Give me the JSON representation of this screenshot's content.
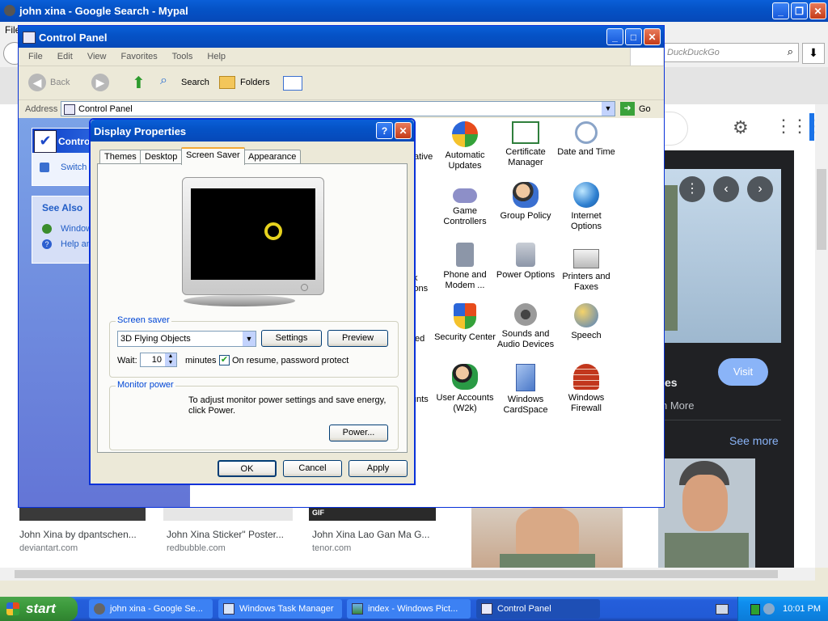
{
  "browser": {
    "title": "john xina - Google Search - Mypal",
    "menu_file": "File",
    "search_placeholder": "DuckDuckGo",
    "cards": [
      {
        "title": "John Xina by dpantschen...",
        "source": "deviantart.com"
      },
      {
        "title": "John Xina Sticker\" Poster...",
        "source": "redbubble.com"
      },
      {
        "title": "John Xina Lao Gan Ma G...",
        "source": "tenor.com"
      }
    ],
    "gif_badge": "GIF",
    "visit_label": "Visit",
    "partial_es": "es",
    "partial_more": "n More",
    "see_more": "See more"
  },
  "control_panel": {
    "title": "Control Panel",
    "menu": [
      "File",
      "Edit",
      "View",
      "Favorites",
      "Tools",
      "Help"
    ],
    "toolbar": {
      "back": "Back",
      "search": "Search",
      "folders": "Folders"
    },
    "address_label": "Address",
    "address_value": "Control Panel",
    "go_label": "Go",
    "sidebar": {
      "panel_title": "Contro",
      "switch_link": "Switch",
      "see_also": "See Also",
      "link1": "Window",
      "link2": "Help an"
    },
    "partial_labels": [
      "ative",
      "k",
      "ions",
      "ed",
      "unts"
    ],
    "icons": [
      {
        "label": "Automatic Updates",
        "icon": "automatic-updates-icon"
      },
      {
        "label": "Certificate Manager",
        "icon": "certificate-icon"
      },
      {
        "label": "Date and Time",
        "icon": "clock-icon"
      },
      {
        "label": "Game Controllers",
        "icon": "gamepad-icon"
      },
      {
        "label": "Group Policy",
        "icon": "group-policy-icon"
      },
      {
        "label": "Internet Options",
        "icon": "globe-icon"
      },
      {
        "label": "Phone and Modem ...",
        "icon": "phone-icon"
      },
      {
        "label": "Power Options",
        "icon": "power-icon"
      },
      {
        "label": "Printers and Faxes",
        "icon": "printer-icon"
      },
      {
        "label": "Security Center",
        "icon": "shield-icon"
      },
      {
        "label": "Sounds and Audio Devices",
        "icon": "speaker-icon"
      },
      {
        "label": "Speech",
        "icon": "speech-icon"
      },
      {
        "label": "User Accounts (W2k)",
        "icon": "users-icon"
      },
      {
        "label": "Windows CardSpace",
        "icon": "cardspace-icon"
      },
      {
        "label": "Windows Firewall",
        "icon": "firewall-icon"
      }
    ]
  },
  "dialog": {
    "title": "Display Properties",
    "help_glyph": "?",
    "tabs": [
      "Themes",
      "Desktop",
      "Screen Saver",
      "Appearance"
    ],
    "active_tab": "Screen Saver",
    "screensaver_group": "Screen saver",
    "screensaver_value": "3D Flying Objects",
    "settings_button": "Settings",
    "preview_button": "Preview",
    "wait_label": "Wait:",
    "wait_value": "10",
    "minutes_label": "minutes",
    "password_label": "On resume, password protect",
    "password_checked": true,
    "monitor_group": "Monitor power",
    "monitor_text": "To adjust monitor power settings and save energy, click Power.",
    "power_button": "Power...",
    "ok": "OK",
    "cancel": "Cancel",
    "apply": "Apply"
  },
  "taskbar": {
    "start": "start",
    "tasks": [
      "john xina - Google Se...",
      "Windows Task Manager",
      "index - Windows Pict...",
      "Control Panel"
    ],
    "clock": "10:01 PM"
  },
  "colors": {
    "xp_blue": "#0553c7",
    "taskbar": "#245edb",
    "start_green": "#3c9a3c",
    "tray": "#0f8ff0"
  }
}
